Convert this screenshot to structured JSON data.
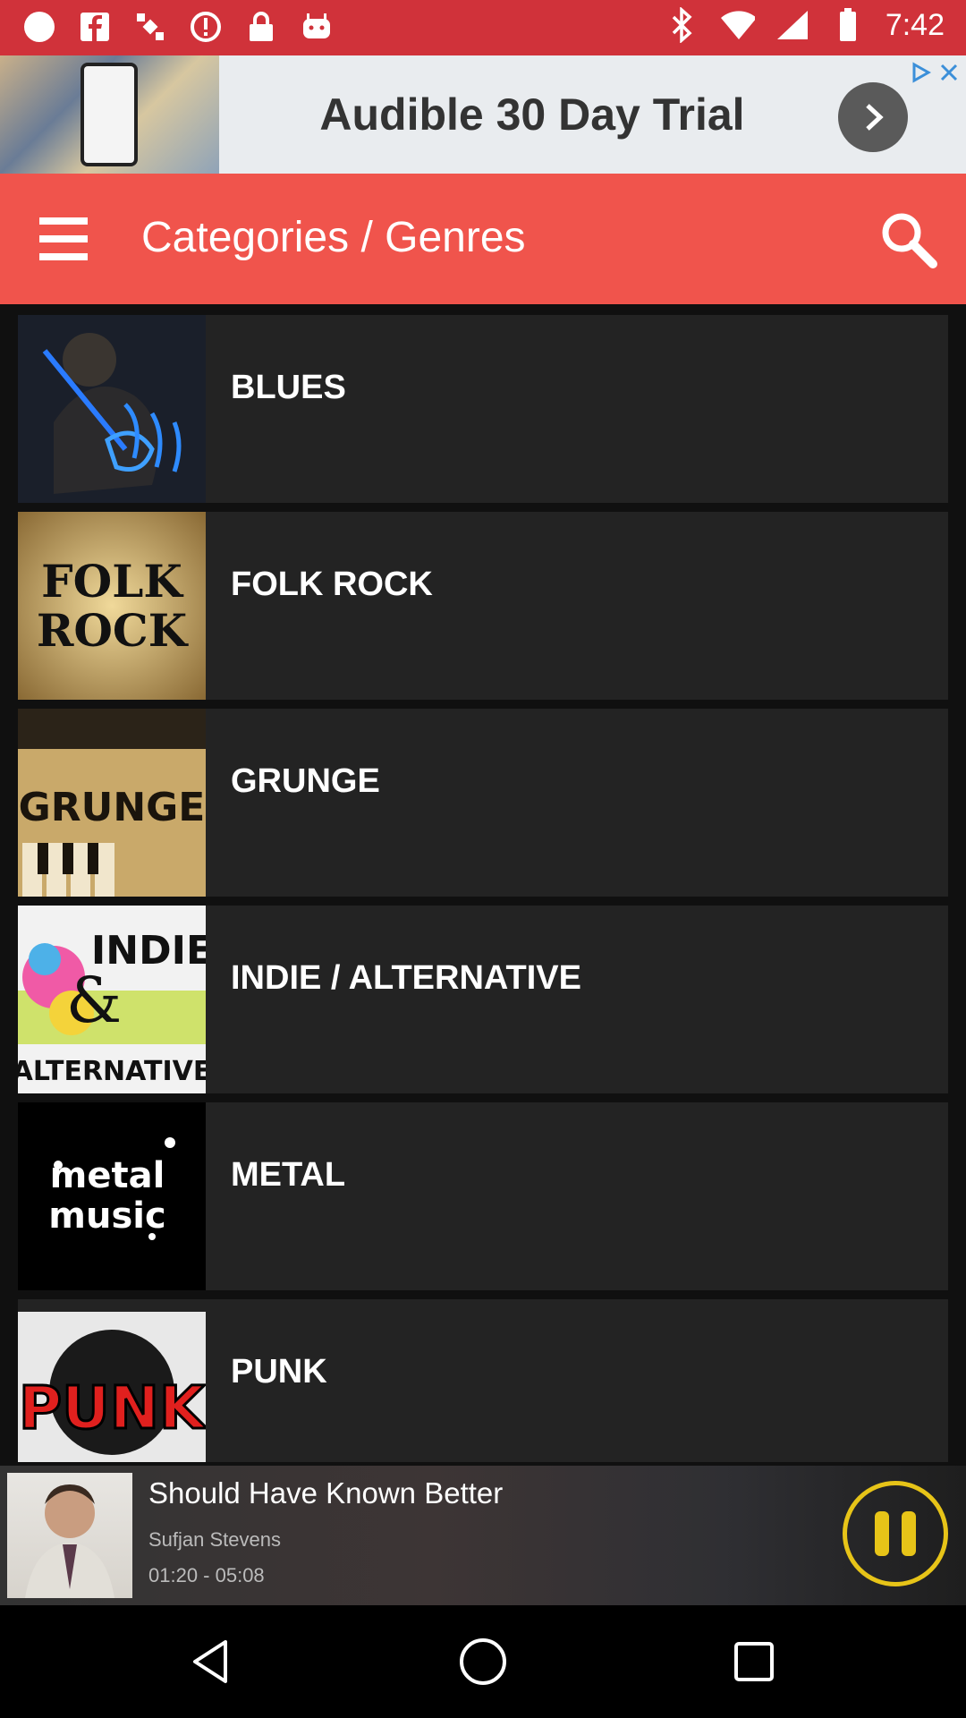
{
  "status_bar": {
    "time": "7:42",
    "left_icons": [
      "circle-icon",
      "facebook-icon",
      "satellite-icon",
      "alert-icon",
      "lock-icon",
      "android-icon"
    ],
    "right_icons": [
      "bluetooth-icon",
      "wifi-icon",
      "signal-icon",
      "battery-icon"
    ]
  },
  "ad_banner": {
    "text": "Audible 30 Day Trial"
  },
  "toolbar": {
    "title": "Categories / Genres",
    "accent_color": "#f0544c"
  },
  "genres": [
    {
      "label": "BLUES",
      "art": "blues-art"
    },
    {
      "label": "FOLK ROCK",
      "art": "folk-rock-art"
    },
    {
      "label": "GRUNGE",
      "art": "grunge-art"
    },
    {
      "label": "INDIE / ALTERNATIVE",
      "art": "indie-alternative-art"
    },
    {
      "label": "METAL",
      "art": "metal-art"
    },
    {
      "label": "PUNK",
      "art": "punk-art"
    }
  ],
  "now_playing": {
    "title": "Should Have Known Better",
    "artist": "Sufjan Stevens",
    "time": "01:20 - 05:08",
    "state": "playing",
    "control_color": "#e7c418"
  }
}
